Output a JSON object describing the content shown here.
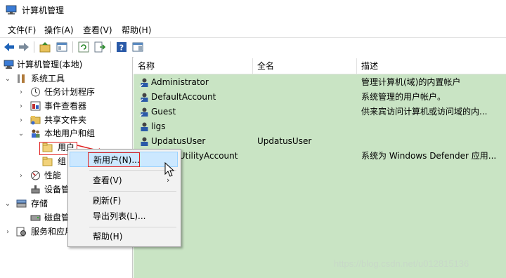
{
  "window": {
    "title": "计算机管理"
  },
  "menubar": {
    "items": [
      "文件(F)",
      "操作(A)",
      "查看(V)",
      "帮助(H)"
    ]
  },
  "tree": {
    "root": "计算机管理(本地)",
    "system_tools": "系统工具",
    "task_scheduler": "任务计划程序",
    "event_viewer": "事件查看器",
    "shared_folders": "共享文件夹",
    "local_users_groups": "本地用户和组",
    "users": "用户",
    "groups": "组",
    "performance": "性能",
    "device_manager": "设备管",
    "storage": "存储",
    "disk_management": "磁盘管",
    "services_apps": "服务和应用"
  },
  "list": {
    "columns": [
      "名称",
      "全名",
      "描述"
    ],
    "rows": [
      {
        "name": "Administrator",
        "fullname": "",
        "desc": "管理计算机(域)的内置帐户"
      },
      {
        "name": "DefaultAccount",
        "fullname": "",
        "desc": "系统管理的用户帐户。"
      },
      {
        "name": "Guest",
        "fullname": "",
        "desc": "供来宾访问计算机或访问域的内..."
      },
      {
        "name": "ligs",
        "fullname": "",
        "desc": ""
      },
      {
        "name": "UpdatusUser",
        "fullname": "UpdatusUser",
        "desc": ""
      },
      {
        "name": "tUtilityAccount",
        "fullname": "",
        "desc": "系统为 Windows Defender 应用..."
      }
    ]
  },
  "context_menu": {
    "new_user": "新用户(N)...",
    "view": "查看(V)",
    "refresh": "刷新(F)",
    "export_list": "导出列表(L)...",
    "help": "帮助(H)"
  },
  "watermark": "https://blog.csdn.net/u012815136",
  "colors": {
    "list_bg": "#c9e4c4",
    "highlight_red": "#e02020",
    "menu_hover": "#cce8ff"
  }
}
